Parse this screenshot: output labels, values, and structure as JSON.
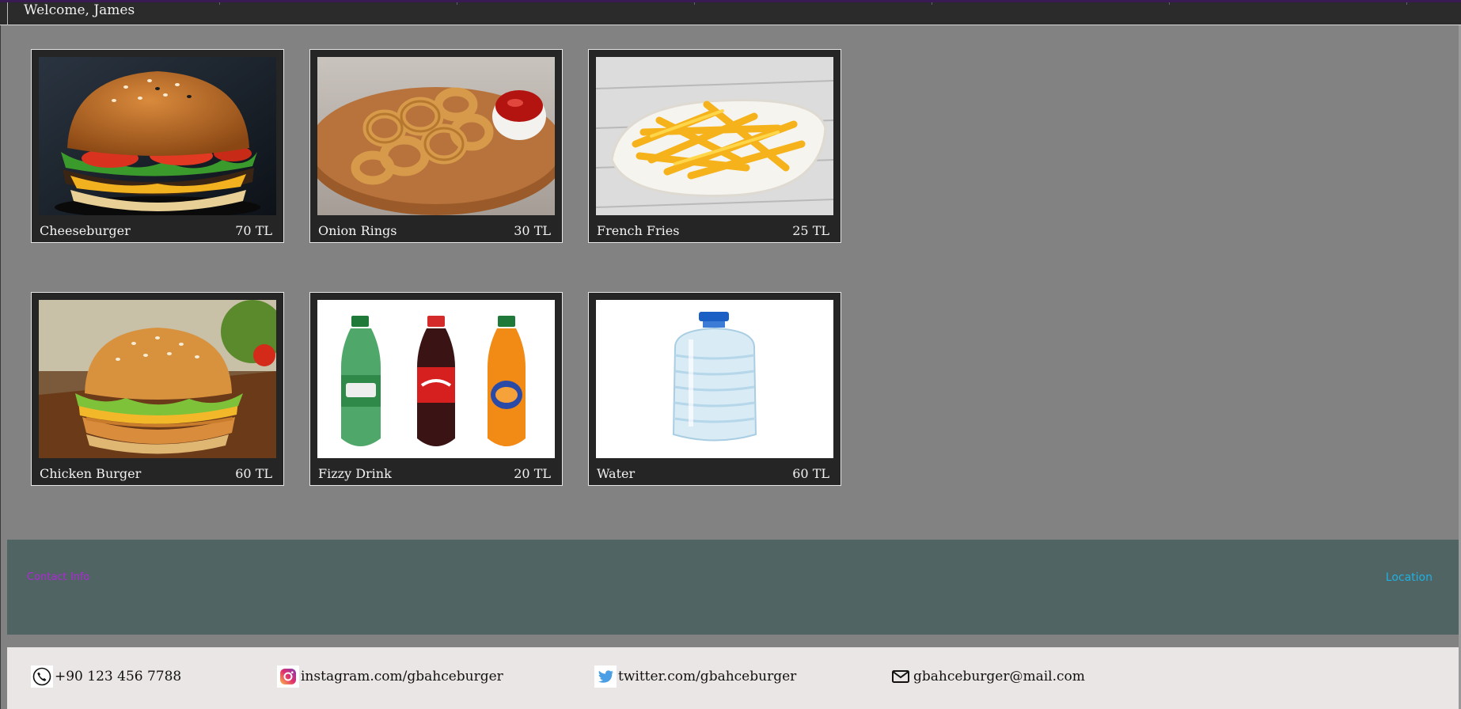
{
  "header": {
    "welcome_text": "Welcome, James"
  },
  "menu": {
    "items": [
      {
        "name": "Cheeseburger",
        "price": "70 TL",
        "image_icon": "cheeseburger-image"
      },
      {
        "name": "Onion Rings",
        "price": "30 TL",
        "image_icon": "onion-rings-image"
      },
      {
        "name": "French Fries",
        "price": "25 TL",
        "image_icon": "french-fries-image"
      },
      {
        "name": "Chicken Burger",
        "price": "60 TL",
        "image_icon": "chicken-burger-image"
      },
      {
        "name": "Fizzy Drink",
        "price": "20 TL",
        "image_icon": "fizzy-drinks-image"
      },
      {
        "name": "Water",
        "price": "60 TL",
        "image_icon": "water-bottle-image"
      }
    ]
  },
  "footer": {
    "contact_label": "Contact Info",
    "location_label": "Location"
  },
  "contact": {
    "phone": "+90 123 456 7788",
    "instagram": "instagram.com/gbahceburger",
    "twitter": "twitter.com/gbahceburger",
    "email": "gbahceburger@mail.com"
  },
  "colors": {
    "page_bg": "#828282",
    "card_bg": "#252525",
    "footer_band": "#506464",
    "contact_strip": "#ebe6e6",
    "contact_link": "#b027d8",
    "location_link": "#1fb0e0",
    "topbar_accent": "#3a1a55"
  }
}
